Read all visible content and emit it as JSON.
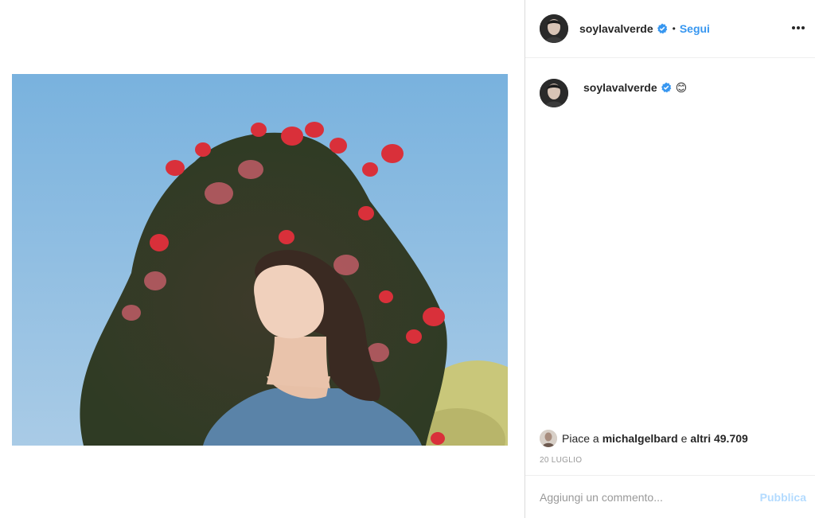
{
  "post": {
    "author": "soylavalverde",
    "verified_icon": "verified-badge-icon",
    "dot": "•",
    "follow_label": "Segui",
    "more_icon": "more-options-icon",
    "photo_description_icon": "post-photo",
    "colors": {
      "accent": "#3897f0",
      "accent_disabled": "#b3dbff",
      "text": "#262626",
      "muted": "#999999",
      "border": "#dbdbdb"
    }
  },
  "caption": {
    "author": "soylavalverde",
    "emoji": "😊"
  },
  "likes": {
    "prefix": "Piace a",
    "liked_by": "michalgelbard",
    "connector": "e",
    "others": "altri 49.709"
  },
  "date": "20 luglio",
  "comment": {
    "placeholder": "Aggiungi un commento...",
    "publish_label": "Pubblica"
  }
}
